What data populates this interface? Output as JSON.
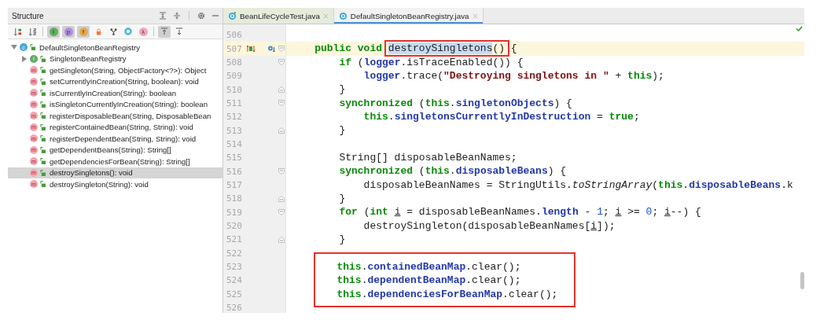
{
  "structure": {
    "title": "Structure",
    "toolbar": [
      {
        "kind": "sort-visibility",
        "on": false
      },
      {
        "kind": "sort-alpha",
        "on": false
      },
      {
        "kind": "badge",
        "glyph": "I",
        "color": "#5fae5f",
        "on": true
      },
      {
        "kind": "badge",
        "glyph": "p",
        "color": "#b08ee0",
        "on": true
      },
      {
        "kind": "badge",
        "glyph": "f",
        "color": "#e3a84a",
        "on": true
      },
      {
        "kind": "lock",
        "on": false
      },
      {
        "kind": "fork",
        "on": false
      },
      {
        "kind": "ring",
        "on": false
      },
      {
        "kind": "badge",
        "glyph": "λ",
        "color": "#f4a6b8",
        "on": false
      },
      {
        "kind": "scroll-to",
        "on": true
      },
      {
        "kind": "scroll-from",
        "on": false
      }
    ],
    "tree": [
      {
        "label": "DefaultSingletonBeanRegistry",
        "kind": "class",
        "badge": "c",
        "expanded": true,
        "selected": false,
        "children": [
          {
            "label": "SingletonBeanRegistry",
            "kind": "interface",
            "badge": "I",
            "expanded": false,
            "selected": false
          },
          {
            "label": "getSingleton(String, ObjectFactory<?>): Object",
            "kind": "method",
            "badge": "m",
            "selected": false
          },
          {
            "label": "setCurrentlyInCreation(String, boolean): void",
            "kind": "method",
            "badge": "m",
            "selected": false
          },
          {
            "label": "isCurrentlyInCreation(String): boolean",
            "kind": "method",
            "badge": "m",
            "selected": false
          },
          {
            "label": "isSingletonCurrentlyInCreation(String): boolean",
            "kind": "method",
            "badge": "m",
            "selected": false
          },
          {
            "label": "registerDisposableBean(String, DisposableBean",
            "kind": "method",
            "badge": "m",
            "selected": false
          },
          {
            "label": "registerContainedBean(String, String): void",
            "kind": "method",
            "badge": "m",
            "selected": false
          },
          {
            "label": "registerDependentBean(String, String): void",
            "kind": "method",
            "badge": "m",
            "selected": false
          },
          {
            "label": "getDependentBeans(String): String[]",
            "kind": "method",
            "badge": "m",
            "selected": false
          },
          {
            "label": "getDependenciesForBean(String): String[]",
            "kind": "method",
            "badge": "m",
            "selected": false
          },
          {
            "label": "destroySingletons(): void",
            "kind": "method",
            "badge": "m",
            "selected": true
          },
          {
            "label": "destroySingleton(String): void",
            "kind": "method",
            "badge": "m",
            "selected": false
          }
        ]
      }
    ]
  },
  "editor": {
    "tabs": [
      {
        "label": "BeanLifeCycleTest.java",
        "kind": "test",
        "selected": false
      },
      {
        "label": "DefaultSingletonBeanRegistry.java",
        "kind": "class",
        "selected": true
      }
    ],
    "lines": [
      {
        "kind": "line",
        "number": "506",
        "current": false
      },
      {
        "kind": "line",
        "number": "507",
        "current": true,
        "markers": [
          {
            "kind": "override"
          },
          {
            "kind": "implemented"
          }
        ],
        "fold": {
          "kind": "start"
        },
        "tokens": [
          {
            "kind": "kw",
            "text": "    public void "
          },
          {
            "kind": "box",
            "tokens": [
              {
                "kind": "selected",
                "text": "destroySingletons"
              },
              {
                "kind": "plain",
                "text": "()"
              }
            ]
          },
          {
            "kind": "plain",
            "text": " {"
          }
        ]
      },
      {
        "kind": "line",
        "number": "508",
        "current": false,
        "fold": {
          "kind": "start"
        },
        "tokens": [
          {
            "kind": "kw",
            "text": "        if"
          },
          {
            "kind": "plain",
            "text": " ("
          },
          {
            "kind": "field",
            "text": "logger"
          },
          {
            "kind": "plain",
            "text": ".isTraceEnabled()) {"
          }
        ]
      },
      {
        "kind": "line",
        "number": "509",
        "current": false,
        "tokens": [
          {
            "kind": "field",
            "text": "            logger"
          },
          {
            "kind": "plain",
            "text": ".trace("
          },
          {
            "kind": "str",
            "text": "\"Destroying singletons in \""
          },
          {
            "kind": "plain",
            "text": " + "
          },
          {
            "kind": "kw",
            "text": "this"
          },
          {
            "kind": "plain",
            "text": ");"
          }
        ]
      },
      {
        "kind": "line",
        "number": "510",
        "current": false,
        "fold": {
          "kind": "end"
        },
        "tokens": [
          {
            "kind": "plain",
            "text": "        }"
          }
        ]
      },
      {
        "kind": "line",
        "number": "511",
        "current": false,
        "fold": {
          "kind": "start"
        },
        "tokens": [
          {
            "kind": "kw",
            "text": "        synchronized"
          },
          {
            "kind": "plain",
            "text": " ("
          },
          {
            "kind": "kw",
            "text": "this"
          },
          {
            "kind": "plain",
            "text": "."
          },
          {
            "kind": "field",
            "text": "singletonObjects"
          },
          {
            "kind": "plain",
            "text": ") {"
          }
        ]
      },
      {
        "kind": "line",
        "number": "512",
        "current": false,
        "tokens": [
          {
            "kind": "kw",
            "text": "            this"
          },
          {
            "kind": "plain",
            "text": "."
          },
          {
            "kind": "field",
            "text": "singletonsCurrentlyInDestruction"
          },
          {
            "kind": "plain",
            "text": " = "
          },
          {
            "kind": "kw",
            "text": "true"
          },
          {
            "kind": "plain",
            "text": ";"
          }
        ]
      },
      {
        "kind": "line",
        "number": "513",
        "current": false,
        "fold": {
          "kind": "end"
        },
        "tokens": [
          {
            "kind": "plain",
            "text": "        }"
          }
        ]
      },
      {
        "kind": "line",
        "number": "514",
        "current": false
      },
      {
        "kind": "line",
        "number": "515",
        "current": false,
        "tokens": [
          {
            "kind": "plain",
            "text": "        String[] disposableBeanNames;"
          }
        ]
      },
      {
        "kind": "line",
        "number": "516",
        "current": false,
        "fold": {
          "kind": "start"
        },
        "tokens": [
          {
            "kind": "kw",
            "text": "        synchronized"
          },
          {
            "kind": "plain",
            "text": " ("
          },
          {
            "kind": "kw",
            "text": "this"
          },
          {
            "kind": "plain",
            "text": "."
          },
          {
            "kind": "field",
            "text": "disposableBeans"
          },
          {
            "kind": "plain",
            "text": ") {"
          }
        ]
      },
      {
        "kind": "line",
        "number": "517",
        "current": false,
        "tokens": [
          {
            "kind": "plain",
            "text": "            disposableBeanNames = StringUtils."
          },
          {
            "kind": "italic",
            "text": "toStringArray"
          },
          {
            "kind": "plain",
            "text": "("
          },
          {
            "kind": "kw",
            "text": "this"
          },
          {
            "kind": "plain",
            "text": "."
          },
          {
            "kind": "field",
            "text": "disposableBeans"
          },
          {
            "kind": "plain",
            "text": ".k"
          }
        ]
      },
      {
        "kind": "line",
        "number": "518",
        "current": false,
        "fold": {
          "kind": "end"
        },
        "tokens": [
          {
            "kind": "plain",
            "text": "        }"
          }
        ]
      },
      {
        "kind": "line",
        "number": "519",
        "current": false,
        "fold": {
          "kind": "start"
        },
        "tokens": [
          {
            "kind": "kw",
            "text": "        for"
          },
          {
            "kind": "plain",
            "text": " ("
          },
          {
            "kind": "kw",
            "text": "int "
          },
          {
            "kind": "var",
            "text": "i"
          },
          {
            "kind": "plain",
            "text": " = disposableBeanNames."
          },
          {
            "kind": "field",
            "text": "length"
          },
          {
            "kind": "plain",
            "text": " - "
          },
          {
            "kind": "num",
            "text": "1"
          },
          {
            "kind": "plain",
            "text": "; "
          },
          {
            "kind": "var",
            "text": "i"
          },
          {
            "kind": "plain",
            "text": " >= "
          },
          {
            "kind": "num",
            "text": "0"
          },
          {
            "kind": "plain",
            "text": "; "
          },
          {
            "kind": "var",
            "text": "i"
          },
          {
            "kind": "plain",
            "text": "--) {"
          }
        ]
      },
      {
        "kind": "line",
        "number": "520",
        "current": false,
        "tokens": [
          {
            "kind": "plain",
            "text": "            destroySingleton(disposableBeanNames["
          },
          {
            "kind": "var",
            "text": "i"
          },
          {
            "kind": "plain",
            "text": "]);"
          }
        ]
      },
      {
        "kind": "line",
        "number": "521",
        "current": false,
        "fold": {
          "kind": "end"
        },
        "tokens": [
          {
            "kind": "plain",
            "text": "        }"
          }
        ]
      },
      {
        "kind": "line",
        "number": "522",
        "current": false
      },
      {
        "kind": "box",
        "lines": [
          {
            "kind": "line",
            "number": "523",
            "current": false,
            "tokens": [
              {
                "kind": "kw",
                "text": "        this"
              },
              {
                "kind": "plain",
                "text": "."
              },
              {
                "kind": "field",
                "text": "containedBeanMap"
              },
              {
                "kind": "plain",
                "text": ".clear();"
              }
            ]
          },
          {
            "kind": "line",
            "number": "524",
            "current": false,
            "tokens": [
              {
                "kind": "kw",
                "text": "        this"
              },
              {
                "kind": "plain",
                "text": "."
              },
              {
                "kind": "field",
                "text": "dependentBeanMap"
              },
              {
                "kind": "plain",
                "text": ".clear();"
              }
            ]
          },
          {
            "kind": "line",
            "number": "525",
            "current": false,
            "tokens": [
              {
                "kind": "kw",
                "text": "        this"
              },
              {
                "kind": "plain",
                "text": "."
              },
              {
                "kind": "field",
                "text": "dependenciesForBeanMap"
              },
              {
                "kind": "plain",
                "text": ".clear();"
              }
            ]
          }
        ]
      },
      {
        "kind": "line",
        "number": "526",
        "current": false
      }
    ]
  }
}
